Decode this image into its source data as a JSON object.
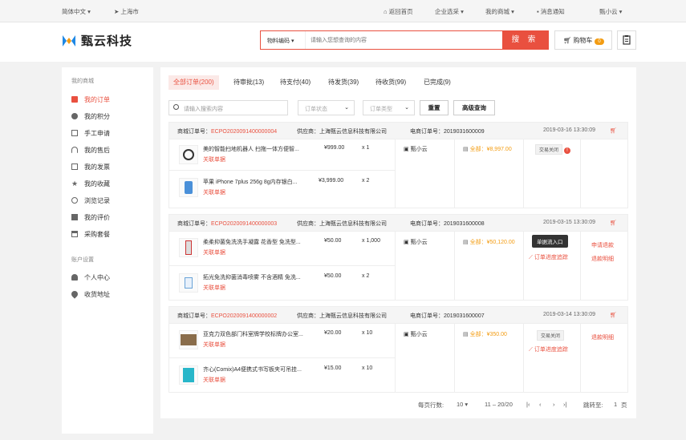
{
  "topbar": {
    "language": "简体中文",
    "location": "上海市",
    "home": "返回首页",
    "enterprise": "企业选采",
    "my_mall": "我的商城",
    "notifications": "消息通知",
    "user": "甄小云"
  },
  "brand": {
    "name": "甄云科技",
    "accent": "#e9503f"
  },
  "search": {
    "type": "物料编码",
    "placeholder": "请输入您想查询的内容",
    "button": "搜 索"
  },
  "cart": {
    "label": "购物车",
    "count": "0"
  },
  "sidebar": {
    "section1": "我的商城",
    "items": [
      {
        "label": "我的订单",
        "icon": "order-icon"
      },
      {
        "label": "我的积分",
        "icon": "points-icon"
      },
      {
        "label": "手工申请",
        "icon": "manual-request-icon"
      },
      {
        "label": "我的售后",
        "icon": "after-sales-icon"
      },
      {
        "label": "我的发票",
        "icon": "invoice-icon"
      },
      {
        "label": "我的收藏",
        "icon": "star-icon"
      },
      {
        "label": "浏览记录",
        "icon": "history-icon"
      },
      {
        "label": "我的评价",
        "icon": "comment-icon"
      },
      {
        "label": "采购套餐",
        "icon": "package-icon"
      }
    ],
    "section2": "账户设置",
    "items2": [
      {
        "label": "个人中心",
        "icon": "user-icon"
      },
      {
        "label": "收货地址",
        "icon": "location-icon"
      }
    ]
  },
  "tabs": [
    "全部订单(200)",
    "待审批(13)",
    "待支付(40)",
    "待发货(39)",
    "待收货(99)",
    "已完成(9)"
  ],
  "filters": {
    "search_placeholder": "请输入搜索内容",
    "status": "订单状态",
    "type": "订单类型",
    "reset": "重置",
    "advanced": "高级查询"
  },
  "labels": {
    "mall_order": "商城订单号：",
    "supplier": "供应商：",
    "ecom_order": "电商订单号：",
    "total": "全部：",
    "related": "关联单据"
  },
  "orders": [
    {
      "order_no": "ECPO2020091400000004",
      "supplier": "上海甄云信息科技有限公司",
      "ecom_no": "2019031600009",
      "date": "2019-03-16 13:30:09",
      "buyer": "甄小云",
      "total": "¥8,997.00",
      "status": "交易关闭",
      "products": [
        {
          "name": "美的智能扫地机器人 扫拖一体方便智...",
          "price": "¥999.00",
          "qty": "x 1"
        },
        {
          "name": "苹果 iPhone 7plus 256g 8g内存银白...",
          "price": "¥3,999.00",
          "qty": "x 2"
        }
      ]
    },
    {
      "order_no": "ECPO2020091400000003",
      "supplier": "上海甄云信息科技有限公司",
      "ecom_no": "2019031600008",
      "date": "2019-03-15 13:30:09",
      "buyer": "甄小云",
      "total": "¥50,120.00",
      "tooltip": "单据流入口",
      "progress": "订单进度追踪",
      "actions": [
        "申请退款",
        "退款明细"
      ],
      "products": [
        {
          "name": "柔柔抑菌免洗洗手凝露 花香型 免洗型...",
          "price": "¥50.00",
          "qty": "x 1,000"
        },
        {
          "name": "拓光免洗抑菌消毒喷雾 不含酒精 免洗...",
          "price": "¥50.00",
          "qty": "x 2"
        }
      ]
    },
    {
      "order_no": "ECPO2020091400000002",
      "supplier": "上海甄云信息科技有限公司",
      "ecom_no": "2019031600007",
      "date": "2019-03-14 13:30:09",
      "buyer": "甄小云",
      "total": "¥350.00",
      "status": "交易关闭",
      "progress": "订单进度追踪",
      "actions": [
        "退款明细"
      ],
      "products": [
        {
          "name": "亚克力双色部门科室牌学校标牌办公室...",
          "price": "¥20.00",
          "qty": "x 10"
        },
        {
          "name": "齐心(Comix)A4便携式书写板夹可吊挂...",
          "price": "¥15.00",
          "qty": "x 10"
        }
      ]
    }
  ],
  "pager": {
    "per_page_label": "每页行数:",
    "per_page": "10",
    "range": "11 – 20/20",
    "jump_label": "跳转至:",
    "page": "1",
    "page_unit": "页"
  }
}
